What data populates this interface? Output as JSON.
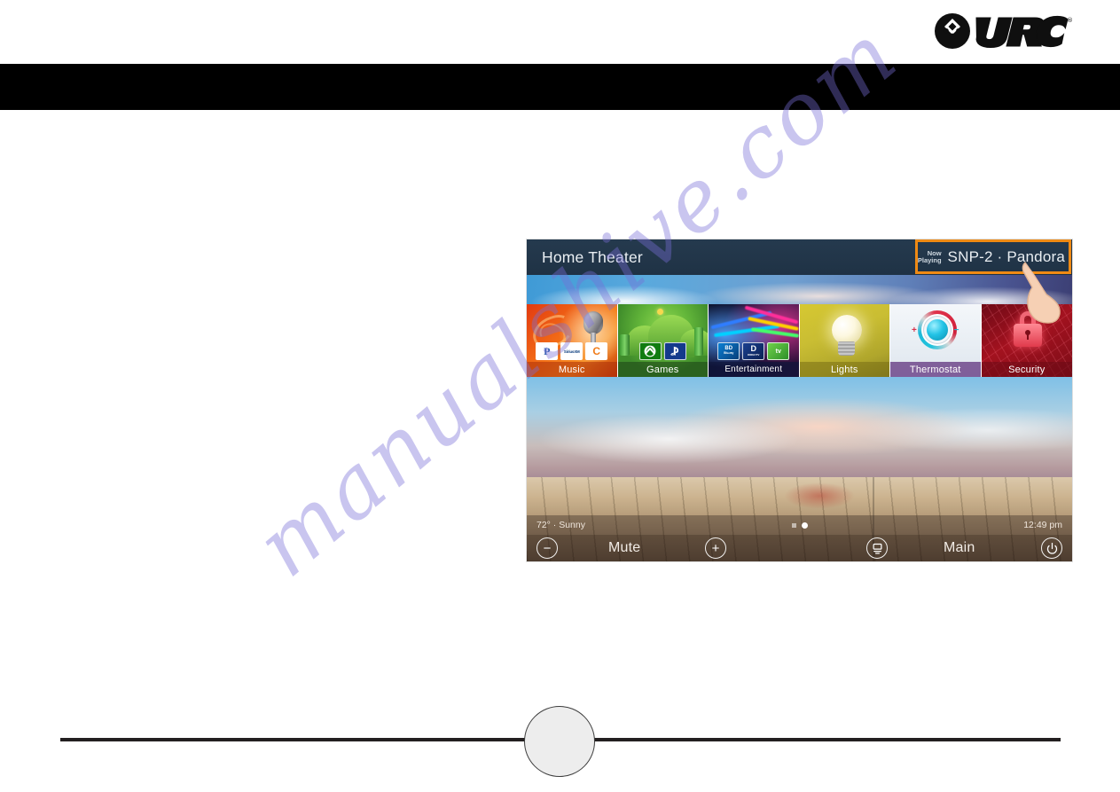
{
  "brand": {
    "logo_text": "URC",
    "logo_registered": "®",
    "logo_name": "urc-logo"
  },
  "banner": {
    "color": "#000000"
  },
  "watermark": {
    "text": "manualshive.com",
    "color": "#786ED7"
  },
  "device": {
    "header": {
      "title": "Home Theater",
      "now_playing_label_line1": "Now",
      "now_playing_label_line2": "Playing",
      "now_playing_value": "SNP-2 · Pandora",
      "highlight_color": "#EF8A14"
    },
    "tiles": [
      {
        "label": "Music",
        "badges": [
          "P",
          "SiriusXM",
          "C"
        ]
      },
      {
        "label": "Games",
        "badges": [
          "Xbox",
          "PlayStation"
        ]
      },
      {
        "label": "Entertainment",
        "badges": [
          "Blu-ray",
          "DIRECTV",
          "tv"
        ]
      },
      {
        "label": "Lights",
        "badges": []
      },
      {
        "label": "Thermostat",
        "badges": []
      },
      {
        "label": "Security",
        "badges": []
      }
    ],
    "status": {
      "weather": "72° · Sunny",
      "time": "12:49 pm",
      "pages": 2,
      "active_page": 2
    },
    "controls": {
      "volume_down": "−",
      "mute": "Mute",
      "volume_up": "+",
      "rooms_icon": "rooms-icon",
      "room": "Main",
      "power_icon": "power-icon"
    },
    "cursor": {
      "icon": "pointing-hand-cursor"
    }
  },
  "footer": {
    "page_circle": ""
  }
}
